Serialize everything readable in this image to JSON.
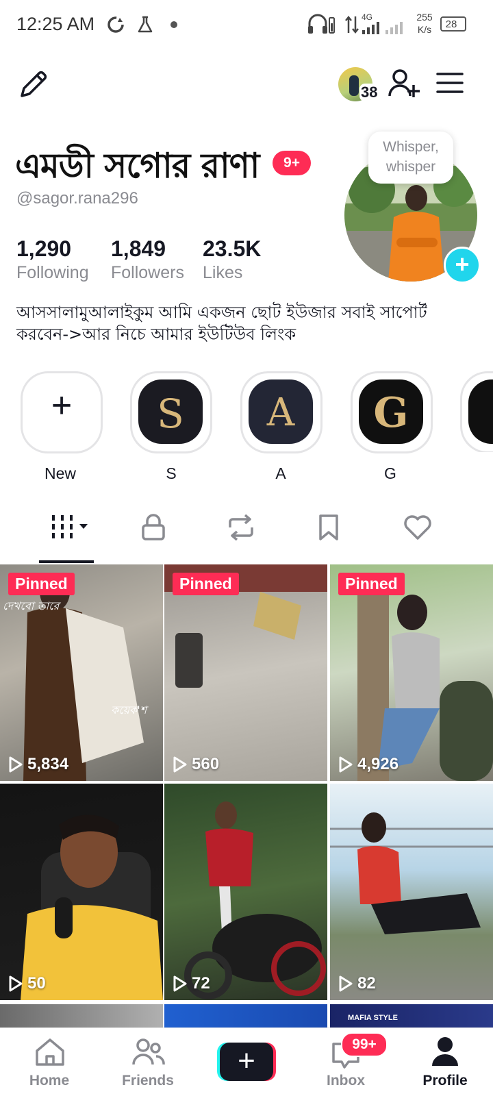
{
  "status_bar": {
    "time": "12:25 AM",
    "network": "4G",
    "speed_value": "255",
    "speed_unit": "K/s",
    "battery": "28"
  },
  "header": {
    "story_count": "38",
    "icons": [
      "edit-icon",
      "add-friend-icon",
      "menu-icon"
    ]
  },
  "profile": {
    "display_name": "এমডী সগোর রাণা",
    "notification_badge": "9+",
    "username": "@sagor.rana296",
    "stats": [
      {
        "value": "1,290",
        "label": "Following"
      },
      {
        "value": "1,849",
        "label": "Followers"
      },
      {
        "value": "23.5K",
        "label": "Likes"
      }
    ],
    "bio_line1": "আসসালামুআলাইকুম আমি একজন ছোট ইউজার সবাই সাপোর্ট",
    "bio_line2": "করবেন->আর নিচে আমার ইউটিউব লিংক",
    "whisper_line1": "Whisper,",
    "whisper_line2": "whisper"
  },
  "highlights": [
    {
      "label": "New",
      "glyph": "+"
    },
    {
      "label": "S",
      "glyph": "S"
    },
    {
      "label": "A",
      "glyph": "A"
    },
    {
      "label": "G",
      "glyph": "G"
    }
  ],
  "tabs": [
    "videos-tab",
    "private-tab",
    "reposts-tab",
    "favorites-tab",
    "liked-tab"
  ],
  "videos": [
    {
      "pinned": "Pinned",
      "views": "5,834",
      "overlay": "দেখবো তারে",
      "overlay2": "কয়েক'শ"
    },
    {
      "pinned": "Pinned",
      "views": "560"
    },
    {
      "pinned": "Pinned",
      "views": "4,926"
    },
    {
      "views": "50"
    },
    {
      "views": "72"
    },
    {
      "views": "82"
    },
    {
      "caption": "MAFIA STYLE"
    }
  ],
  "nav": {
    "home": "Home",
    "friends": "Friends",
    "inbox": "Inbox",
    "inbox_badge": "99+",
    "profile": "Profile"
  },
  "colors": {
    "accent_red": "#fe2c55",
    "accent_cyan": "#20d5ec",
    "text_primary": "#161823",
    "text_secondary": "#8a8b91"
  }
}
